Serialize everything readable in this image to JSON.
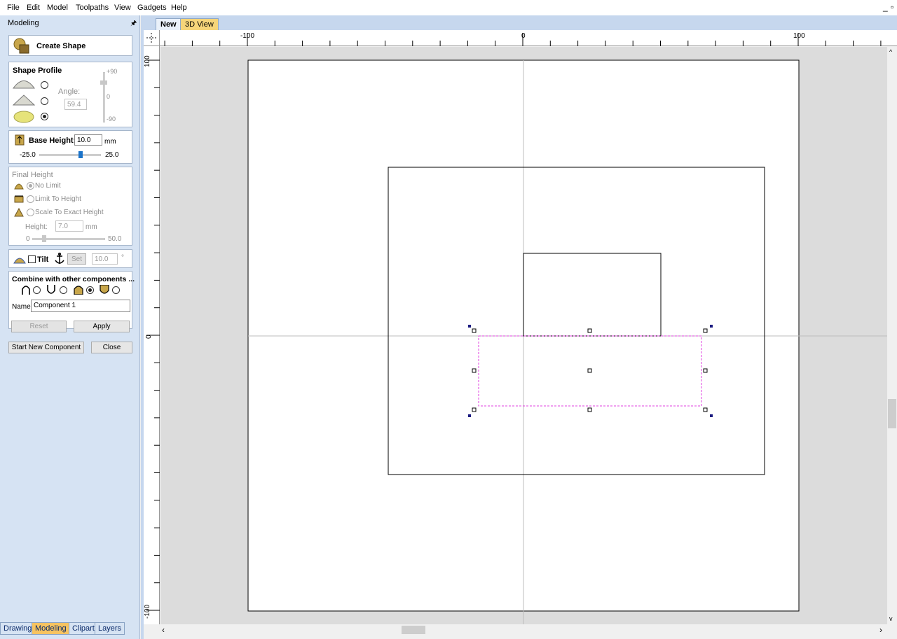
{
  "menu": [
    "File",
    "Edit",
    "Model",
    "Toolpaths",
    "View",
    "Gadgets",
    "Help"
  ],
  "window_controls": [
    "_",
    "▫"
  ],
  "panel": {
    "title": "Modeling",
    "pin_glyph": "🖈",
    "create_shape": "Create Shape",
    "shape_profile": {
      "title": "Shape Profile",
      "angle_label": "Angle:",
      "angle_value": "59.4",
      "scale_top": "+90",
      "scale_mid": "0",
      "scale_bottom": "-90",
      "selected_profile": 3
    },
    "base_height": {
      "label": "Base Height:",
      "value": "10.0",
      "unit": "mm",
      "min": "-25.0",
      "max": "25.0"
    },
    "final_height": {
      "title": "Final Height",
      "options": [
        "No Limit",
        "Limit To Height",
        "Scale To Exact Height"
      ],
      "height_label": "Height:",
      "height_value": "7.0",
      "unit": "mm",
      "min": "0",
      "max": "50.0"
    },
    "tilt": {
      "label": "Tilt",
      "set_label": "Set",
      "value": "10.0",
      "degree": "°"
    },
    "combine": {
      "title": "Combine with other components ...",
      "selected": 3,
      "name_label": "Name",
      "name_value": "Component 1"
    },
    "reset_label": "Reset",
    "apply_label": "Apply",
    "start_new_label": "Start New Component",
    "close_label": "Close"
  },
  "bottom_tabs": [
    "Drawing",
    "Modeling",
    "Clipart",
    "Layers"
  ],
  "active_bottom_tab": "Modeling",
  "doc_tabs": [
    "New",
    "3D View"
  ],
  "active_doc_tab": "New",
  "ruler_h_labels": [
    "-100",
    "0",
    "100"
  ],
  "ruler_v_labels": [
    "100",
    "0",
    "-100"
  ],
  "colors": {
    "panel_bg": "#d6e3f3",
    "active_tab": "#f6c360",
    "selection": "#e040e0",
    "handle": "#1a1a80"
  }
}
